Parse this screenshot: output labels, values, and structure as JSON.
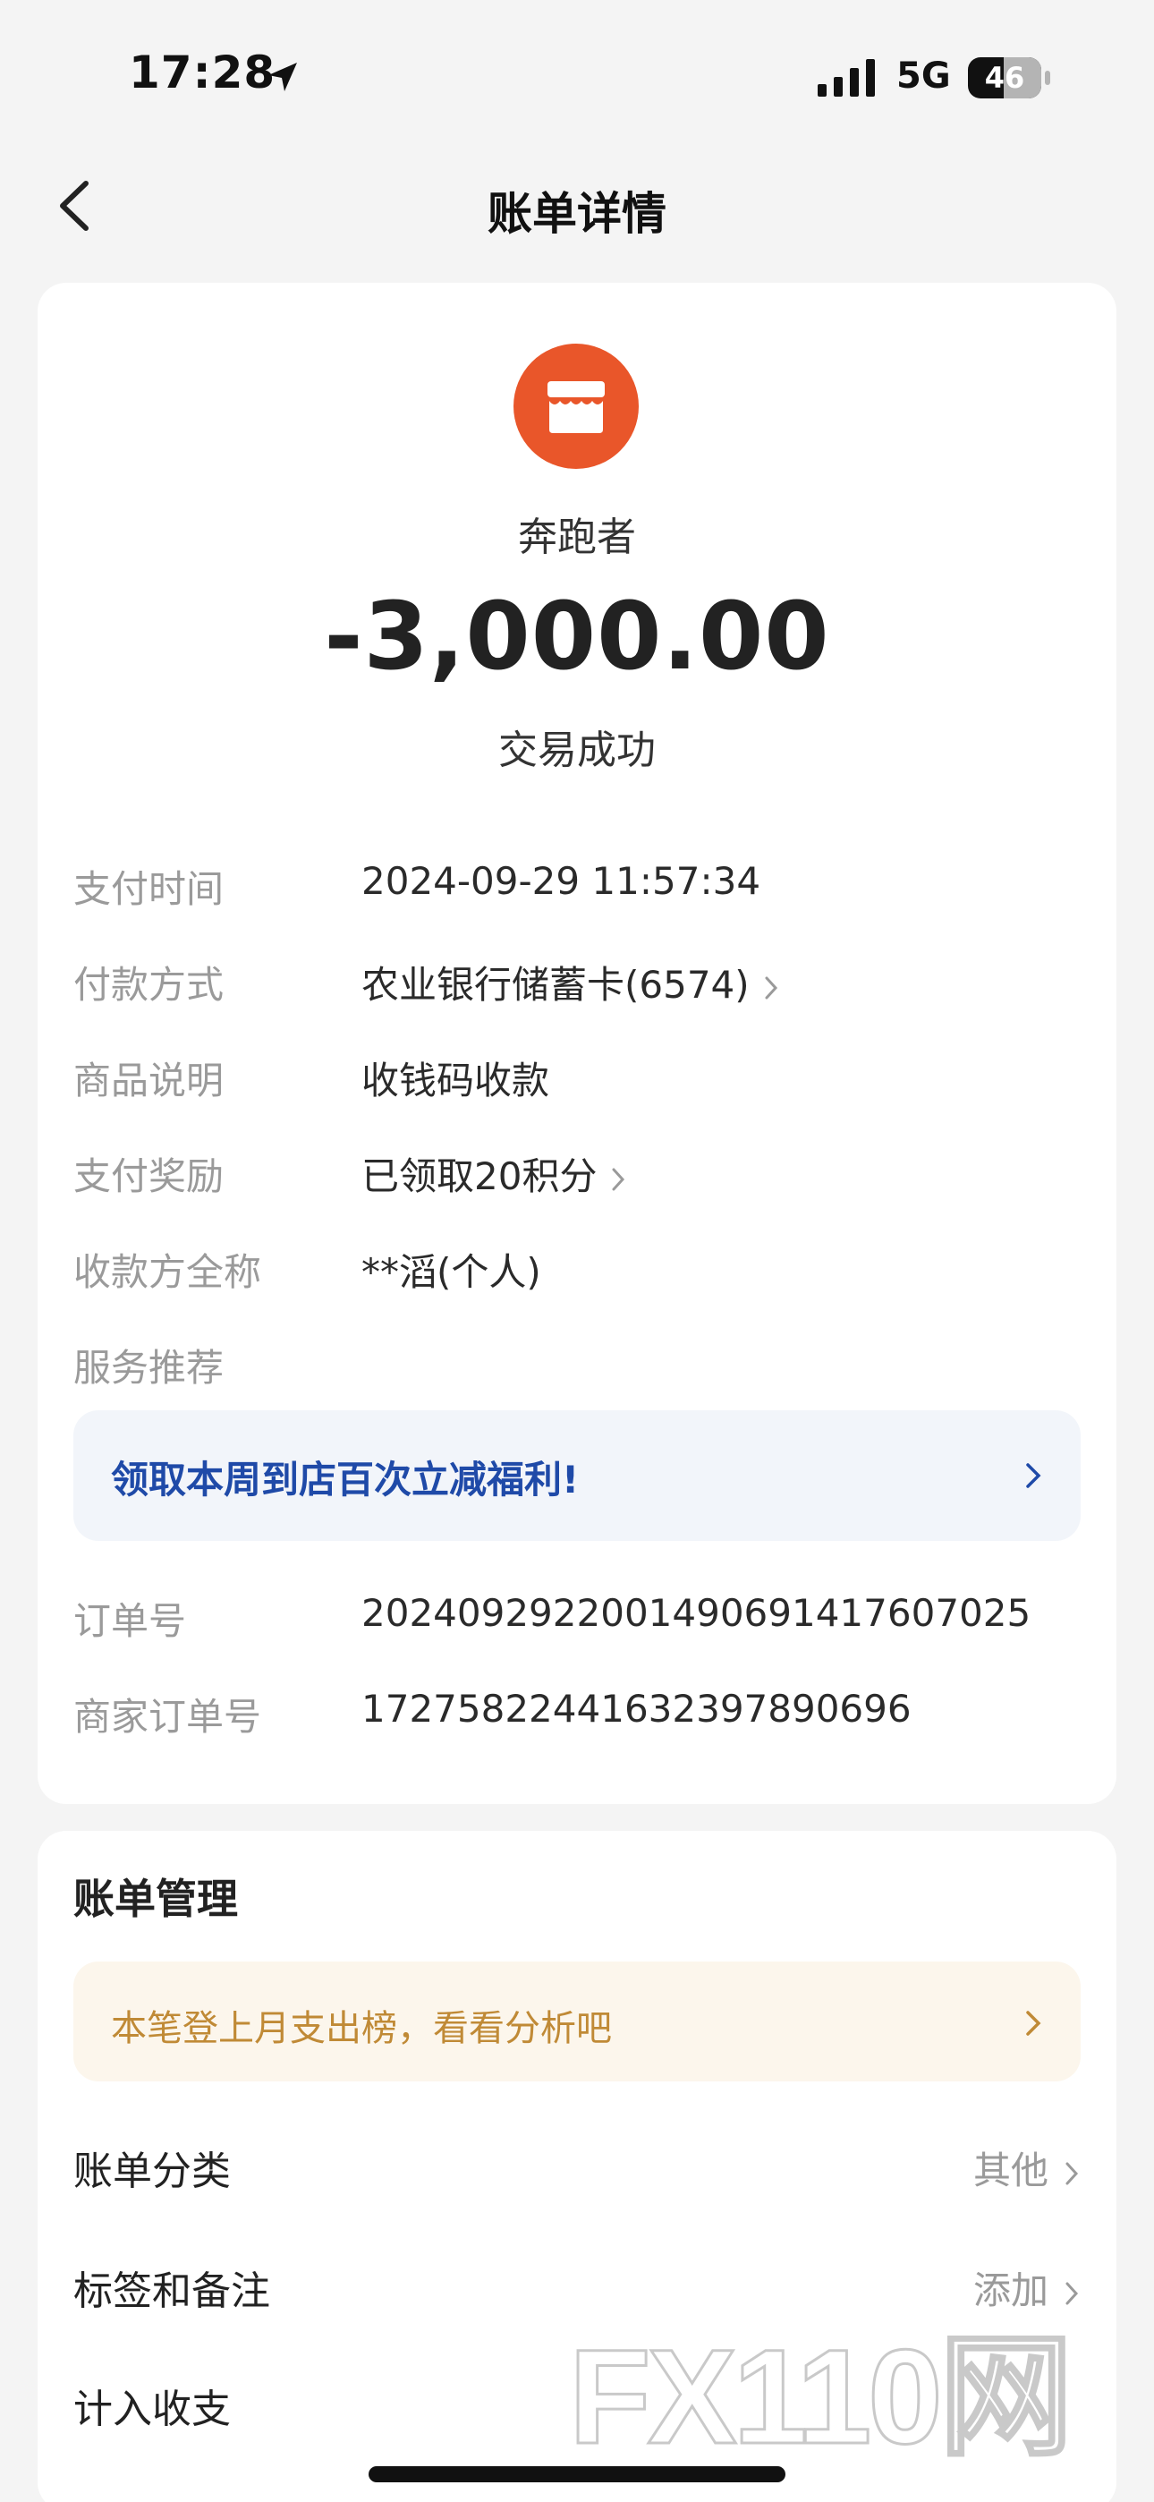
{
  "status_bar": {
    "time": "17:28",
    "network": "5G",
    "battery": "46"
  },
  "nav": {
    "title": "账单详情"
  },
  "transaction": {
    "merchant": "奔跑者",
    "amount": "-3,000.00",
    "status": "交易成功",
    "icon": "store-icon",
    "icon_color": "#e9562a"
  },
  "details": [
    {
      "label": "支付时间",
      "value": "2024-09-29 11:57:34"
    },
    {
      "label": "付款方式",
      "value": "农业银行储蓄卡(6574)"
    },
    {
      "label": "商品说明",
      "value": "收钱码收款"
    },
    {
      "label": "支付奖励",
      "value": "已领取20积分"
    },
    {
      "label": "收款方全称",
      "value": "**滔(个人)"
    },
    {
      "label": "服务推荐",
      "value": ""
    }
  ],
  "promo": {
    "text": "领取本周到店百次立减福利!"
  },
  "orders": [
    {
      "label": "订单号",
      "value": "2024092922001490691417607025"
    },
    {
      "label": "商家订单号",
      "value": "17275822441632397890696"
    }
  ],
  "management": {
    "title": "账单管理",
    "tip": "本笔登上月支出榜，看看分析吧",
    "rows": [
      {
        "label": "账单分类",
        "value": "其他"
      },
      {
        "label": "标签和备注",
        "value": "添加"
      },
      {
        "label": "计入收支",
        "value": ""
      }
    ]
  },
  "watermark": {
    "text": "FX110网"
  },
  "colors": {
    "accent_orange": "#e9562a",
    "promo_blue": "#1f4aa8",
    "tip_gold": "#c08a36"
  }
}
